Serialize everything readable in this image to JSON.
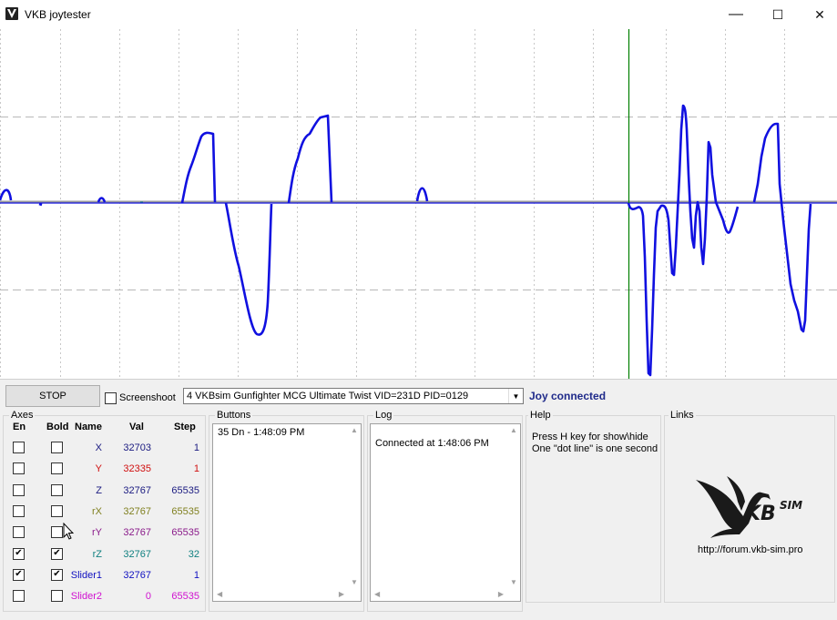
{
  "window": {
    "title": "VKB joytester",
    "minimize_glyph": "—",
    "maximize_glyph": "☐",
    "close_glyph": "✕"
  },
  "plot": {
    "colors": {
      "axis_line": "#1414e0",
      "cursor": "#008000",
      "grid": "#bdbdbd"
    }
  },
  "toolbar": {
    "stop_label": "STOP",
    "screenshot_label": "Screenshoot",
    "device_selected": "4  VKBsim Gunfighter MCG Ultimate Twist  VID=231D PID=0129",
    "status": "Joy connected",
    "status_color": "#1f2a8a"
  },
  "axes": {
    "title": "Axes",
    "headers": {
      "en": "En",
      "bold": "Bold",
      "name": "Name",
      "val": "Val",
      "step": "Step"
    },
    "rows": [
      {
        "name": "X",
        "val": "32703",
        "step": "1",
        "color": "#1a1a80",
        "en": false,
        "bold": false
      },
      {
        "name": "Y",
        "val": "32335",
        "step": "1",
        "color": "#d01010",
        "en": false,
        "bold": false
      },
      {
        "name": "Z",
        "val": "32767",
        "step": "65535",
        "color": "#1a1a80",
        "en": false,
        "bold": false
      },
      {
        "name": "rX",
        "val": "32767",
        "step": "65535",
        "color": "#808020",
        "en": false,
        "bold": false
      },
      {
        "name": "rY",
        "val": "32767",
        "step": "65535",
        "color": "#8a1a8a",
        "en": false,
        "bold": false
      },
      {
        "name": "rZ",
        "val": "32767",
        "step": "32",
        "color": "#108080",
        "en": true,
        "bold": true
      },
      {
        "name": "Slider1",
        "val": "32767",
        "step": "1",
        "color": "#1010c0",
        "en": true,
        "bold": true
      },
      {
        "name": "Slider2",
        "val": "0",
        "step": "65535",
        "color": "#d010d0",
        "en": false,
        "bold": false
      }
    ]
  },
  "buttons": {
    "title": "Buttons",
    "items": [
      "35 Dn - 1:48:09 PM"
    ]
  },
  "log": {
    "title": "Log",
    "items": [
      "Connected at 1:48:06 PM"
    ]
  },
  "help": {
    "title": "Help",
    "line1": "Press H key for show\\hide",
    "line2": "One \"dot line\" is one second"
  },
  "links": {
    "title": "Links",
    "logo_text": "VKB sim",
    "url": "http://forum.vkb-sim.pro"
  }
}
